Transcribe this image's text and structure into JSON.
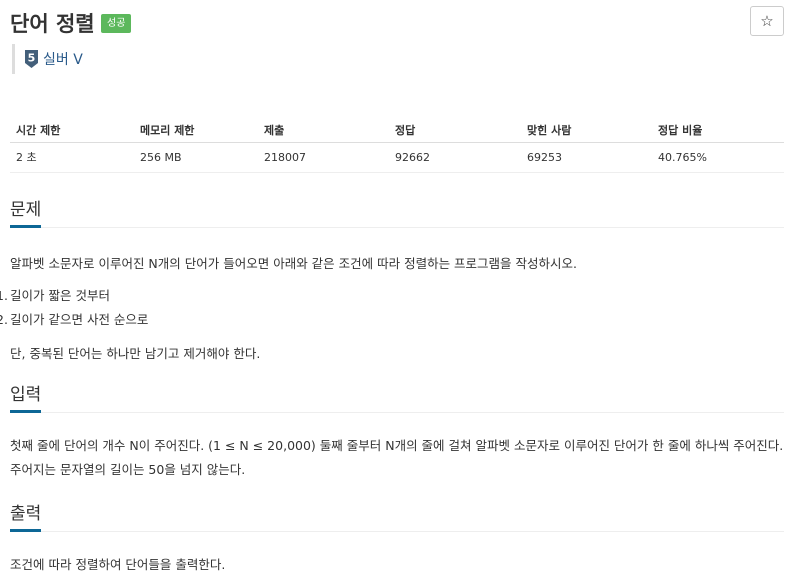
{
  "problem": {
    "title": "단어 정렬",
    "status_badge": "성공",
    "star_icon": "☆"
  },
  "tier": {
    "level_number": "5",
    "label": "실버 V",
    "icon": "silver-tier-icon",
    "icon_color": "#435f7a"
  },
  "stats": {
    "headers": [
      "시간 제한",
      "메모리 제한",
      "제출",
      "정답",
      "맞힌 사람",
      "정답 비율"
    ],
    "values": [
      "2 초",
      "256 MB",
      "218007",
      "92662",
      "69253",
      "40.765%"
    ]
  },
  "sections": {
    "problem": {
      "heading": "문제",
      "intro": "알파벳 소문자로 이루어진 N개의 단어가 들어오면 아래와 같은 조건에 따라 정렬하는 프로그램을 작성하시오.",
      "items": [
        {
          "num": "1.",
          "text": "길이가 짧은 것부터"
        },
        {
          "num": "2.",
          "text": "길이가 같으면 사전 순으로"
        }
      ],
      "note": "단, 중복된 단어는 하나만 남기고 제거해야 한다."
    },
    "input": {
      "heading": "입력",
      "body": "첫째 줄에 단어의 개수 N이 주어진다. (1 ≤ N ≤ 20,000) 둘째 줄부터 N개의 줄에 걸쳐 알파벳 소문자로 이루어진 단어가 한 줄에 하나씩 주어진다. 주어지는 문자열의 길이는 50을 넘지 않는다."
    },
    "output": {
      "heading": "출력",
      "body": "조건에 따라 정렬하여 단어들을 출력한다."
    }
  },
  "colors": {
    "accent": "#0d6796",
    "success": "#5cb85c",
    "tier_label": "#2a5a8a"
  }
}
